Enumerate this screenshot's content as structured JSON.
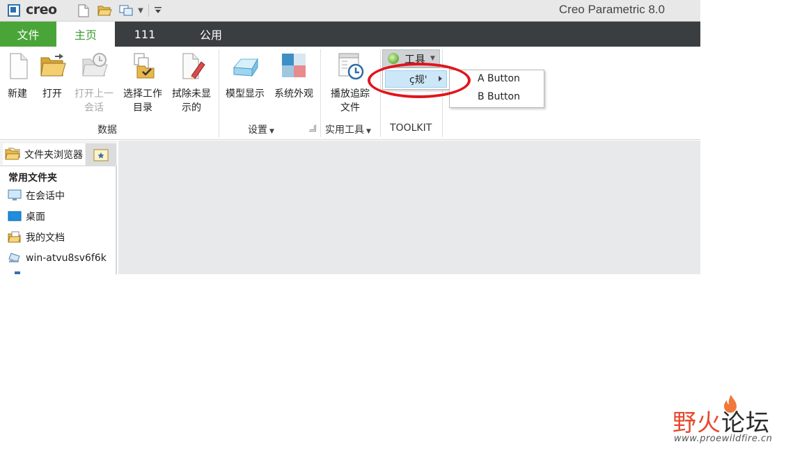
{
  "titlebar": {
    "logo_text": "creo",
    "app_title": "Creo Parametric 8.0",
    "quick_access": [
      "new-icon",
      "open-folder-icon",
      "window-icon",
      "dropdown-arrow",
      "customize-arrow"
    ]
  },
  "tabs": [
    {
      "label": "文件",
      "active": false
    },
    {
      "label": "主页",
      "active": true
    },
    {
      "label": "111",
      "active": false
    },
    {
      "label": "公用",
      "active": false
    }
  ],
  "ribbon": {
    "groups": {
      "data": "数据",
      "settings": "设置",
      "utilities": "实用工具",
      "toolkit": "TOOLKIT"
    },
    "buttons": {
      "new_line1": "新建",
      "open_line1": "打开",
      "open_last_line1": "打开上一",
      "open_last_line2": "会话",
      "select_dir_line1": "选择工作",
      "select_dir_line2": "目录",
      "erase_line1": "拭除未显",
      "erase_line2": "示的",
      "model_display_line1": "模型显示",
      "system_appearance_line1": "系统外观",
      "playback_line1": "播放追踪",
      "playback_line2": "文件"
    },
    "tools_menu": {
      "label": "工具",
      "submenu_label": "ç规'",
      "submenu_items": [
        "A Button",
        "B Button"
      ]
    }
  },
  "navigator": {
    "tab_label": "文件夹浏览器",
    "section_header": "常用文件夹",
    "items": [
      {
        "label": "在会话中",
        "icon": "monitor-icon"
      },
      {
        "label": "桌面",
        "icon": "desktop-icon"
      },
      {
        "label": "我的文档",
        "icon": "documents-icon"
      },
      {
        "label": "win-atvu8sv6f6k",
        "icon": "network-computer-icon"
      }
    ]
  },
  "watermark": {
    "title_part1": "野火",
    "title_part2": "论坛",
    "url": "www.proewildfire.cn"
  },
  "colors": {
    "file_tab": "#4aa539",
    "tab_strip": "#3a3e40",
    "active_tab_text": "#3a9a2e",
    "menu_highlight": "#cce8f8",
    "annotation": "#e1141b"
  }
}
